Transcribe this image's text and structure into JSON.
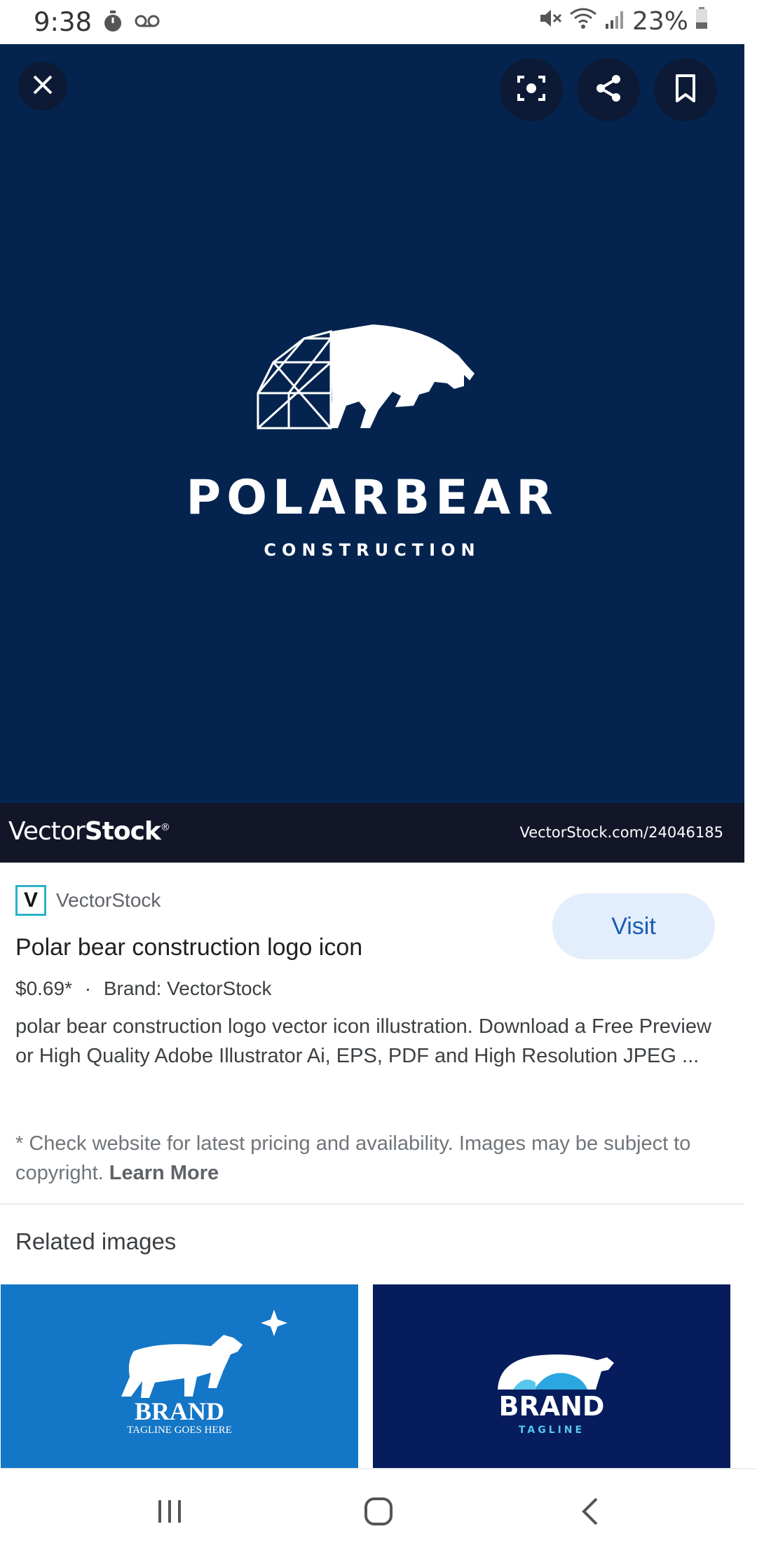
{
  "status_bar": {
    "time": "9:38",
    "battery": "23%",
    "icons": [
      "timer-icon",
      "voicemail-icon",
      "mute-icon",
      "wifi-icon",
      "signal-icon",
      "battery-icon"
    ]
  },
  "viewer": {
    "background": "#04244f",
    "image_logo_title": "POLARBEAR",
    "image_logo_subtitle": "CONSTRUCTION",
    "watermark_brand_light": "Vector",
    "watermark_brand_bold": "Stock",
    "watermark_mark": "®",
    "watermark_url": "VectorStock.com/24046185",
    "buttons": [
      "close-icon",
      "lens-icon",
      "share-icon",
      "bookmark-icon"
    ]
  },
  "result": {
    "source_icon_letter": "V",
    "source_name": "VectorStock",
    "title": "Polar bear construction logo icon",
    "visit_label": "Visit",
    "price": "$0.69*",
    "separator": "·",
    "brand": "Brand: VectorStock",
    "description": "polar bear construction logo vector icon illustration. Download a Free Preview or High Quality Adobe Illustrator Ai, EPS, PDF and High Resolution JPEG ...",
    "disclaimer": "* Check website for latest pricing and availability. Images may be subject to copyright.",
    "learn_more": "Learn More"
  },
  "related": {
    "heading": "Related images",
    "items": [
      {
        "title": "BRAND",
        "tagline": "TAGLINE GOES HERE",
        "bg": "#1476c6"
      },
      {
        "title": "BRAND",
        "tagline": "TAGLINE",
        "bg": "#061c5c"
      }
    ]
  },
  "nav": [
    "recent-apps-icon",
    "home-icon",
    "back-icon"
  ]
}
